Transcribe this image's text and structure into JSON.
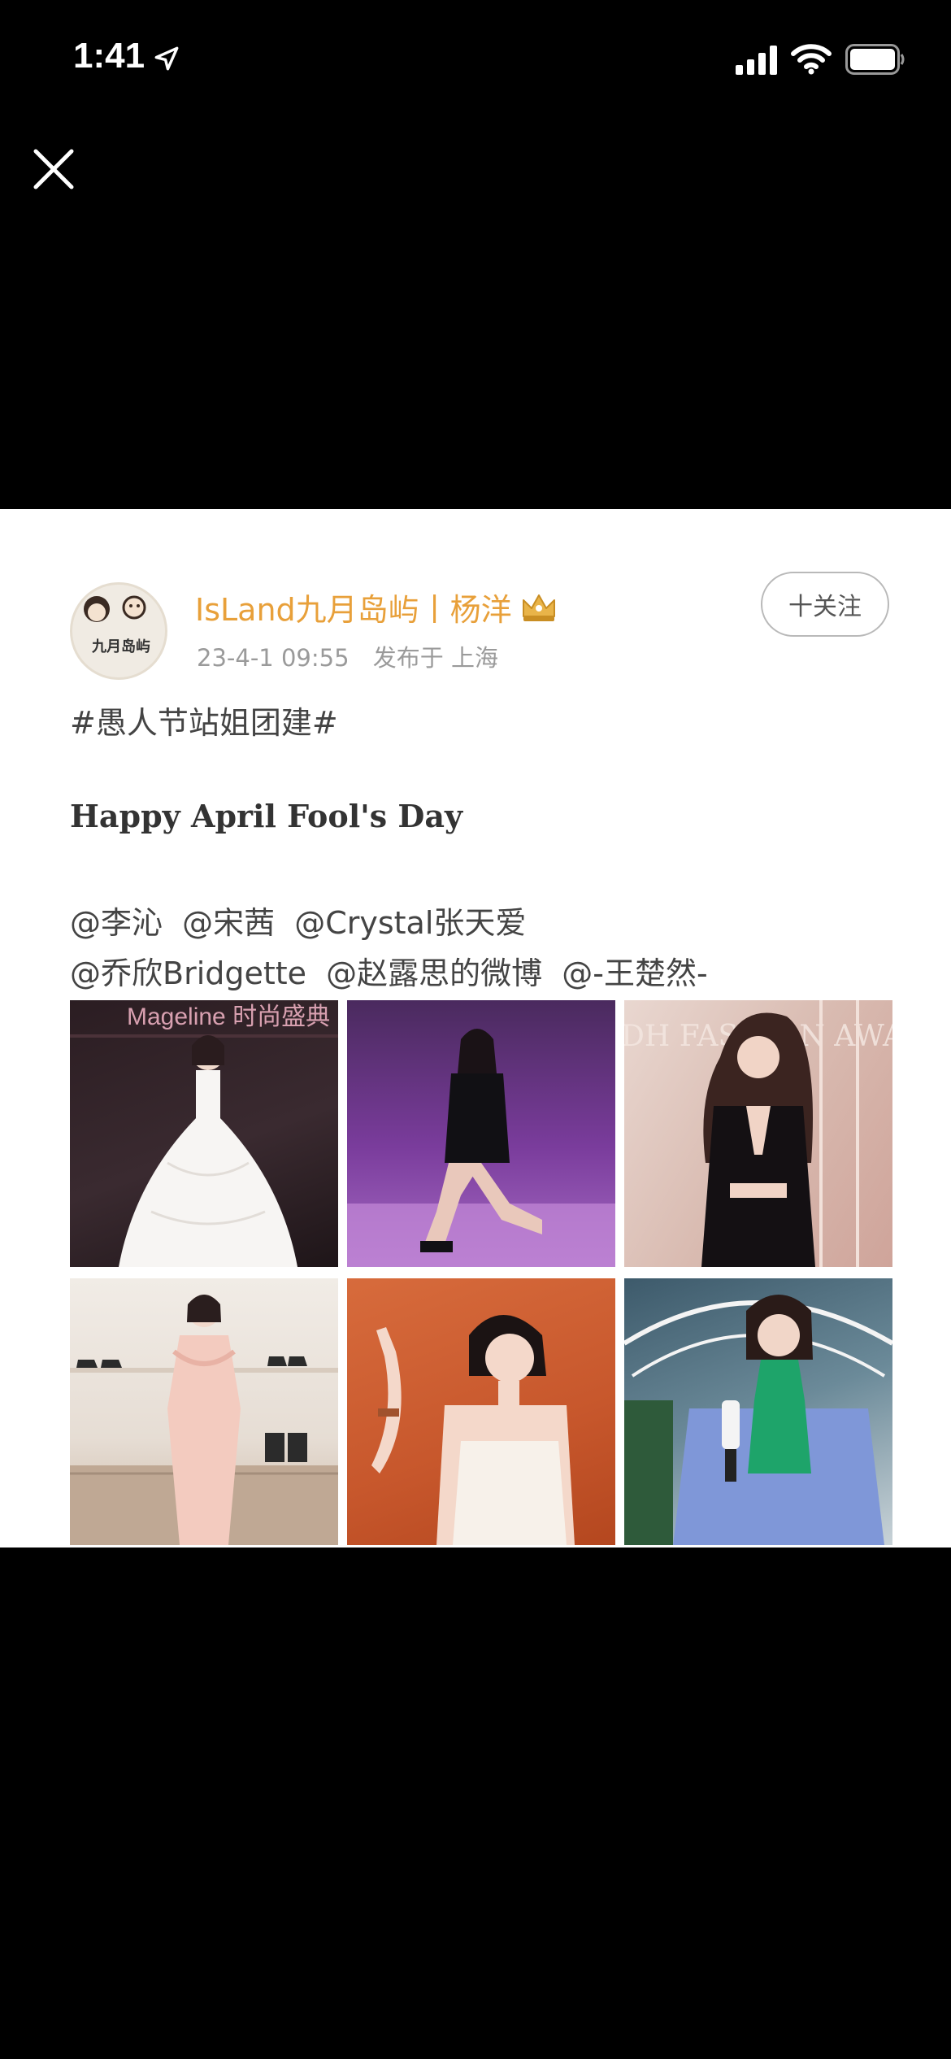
{
  "status_bar": {
    "time": "1:41",
    "icons": [
      "location-arrow-icon",
      "cellular-signal-icon",
      "wifi-icon",
      "battery-icon"
    ]
  },
  "viewer": {
    "close_icon": "close-icon",
    "background_color": "#000000"
  },
  "post": {
    "avatar_text": "九月岛屿",
    "username": "IsLand九月岛屿丨杨洋",
    "badge_icon": "crown-badge-icon",
    "date": "23-4-1 09:55",
    "location": "发布于 上海",
    "follow_label": "十关注",
    "hashtag": "#愚人节站姐团建#",
    "headline": "Happy April Fool's Day",
    "mentions_line1": [
      "@李沁",
      "@宋茜",
      "@Crystal张天爱"
    ],
    "mentions_line2": [
      "@乔欣Bridgette",
      "@赵露思的微博",
      "@-王楚然-"
    ],
    "photos": [
      {
        "caption": "Mageline 时尚盛典",
        "description": "woman in white gown"
      },
      {
        "caption": "",
        "description": "woman in black outfit on purple stage"
      },
      {
        "caption": "DH FASHION AWA",
        "description": "woman with long wavy hair in black top"
      },
      {
        "caption": "",
        "description": "woman in pink dress in shoe store"
      },
      {
        "caption": "",
        "description": "woman in white dress against orange background"
      },
      {
        "caption": "",
        "description": "woman in blue sweater holding microphone"
      }
    ],
    "colors": {
      "username": "#e8a03a",
      "meta": "#9a9a9a",
      "body_text": "#444444"
    }
  }
}
